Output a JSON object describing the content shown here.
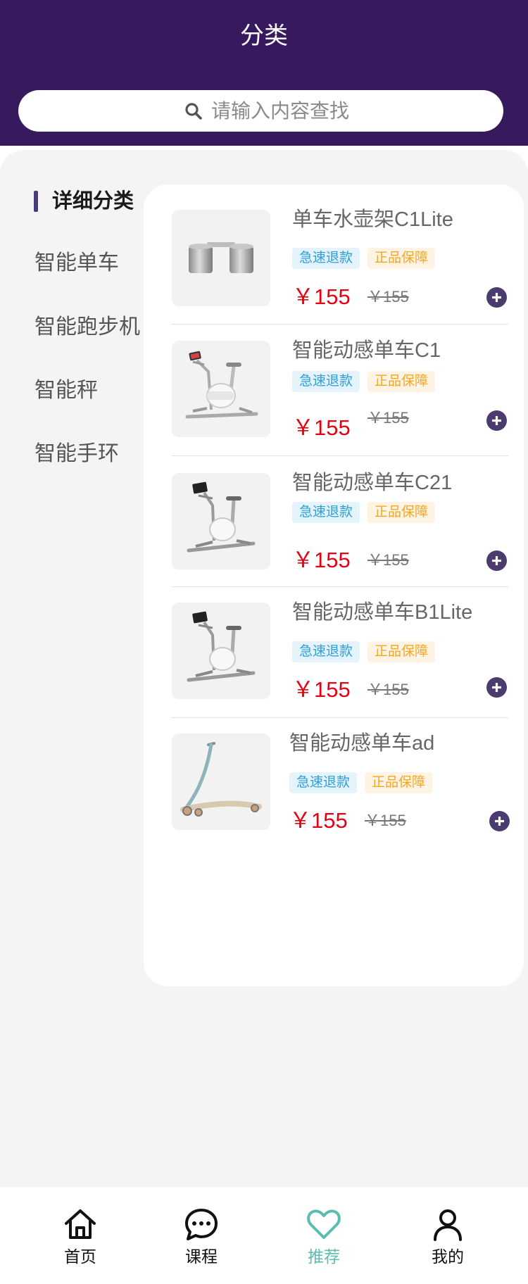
{
  "theme": {
    "header_bg": "#371a5e",
    "accent": "#4b3b6e",
    "price_color": "#e60012",
    "active_nav_color": "#5cbcb0",
    "page_bg": "#f4f4f5"
  },
  "header": {
    "title": "分类"
  },
  "search": {
    "placeholder": "请输入内容查找",
    "icon": "search-icon"
  },
  "sidebar": {
    "heading": "详细分类",
    "items": [
      {
        "label": "智能单车"
      },
      {
        "label": "智能跑步机"
      },
      {
        "label": "智能秤"
      },
      {
        "label": "智能手环"
      }
    ]
  },
  "products": [
    {
      "title": "单车水壶架C1Lite",
      "image": "bottle-cage-image",
      "badges": [
        "急速退款",
        "正品保障"
      ],
      "price": "￥155",
      "original_price": "￥155",
      "action_icon": "plus-circle-icon"
    },
    {
      "title": "智能动感单车C1",
      "image": "exercise-bike-image",
      "badges": [
        "急速退款",
        "正品保障"
      ],
      "price": "￥155",
      "original_price": "￥155",
      "action_icon": "plus-circle-icon"
    },
    {
      "title": "智能动感单车C21",
      "image": "exercise-bike-image",
      "badges": [
        "急速退款",
        "正品保障"
      ],
      "price": "￥155",
      "original_price": "￥155",
      "action_icon": "plus-circle-icon"
    },
    {
      "title": "智能动感单车B1Lite",
      "image": "exercise-bike-image",
      "badges": [
        "急速退款",
        "正品保障"
      ],
      "price": "￥155",
      "original_price": "￥155",
      "action_icon": "plus-circle-icon"
    },
    {
      "title": "智能动感单车ad",
      "image": "scooter-image",
      "badges": [
        "急速退款",
        "正品保障"
      ],
      "price": "￥155",
      "original_price": "￥155",
      "action_icon": "plus-circle-icon"
    }
  ],
  "nav": {
    "items": [
      {
        "label": "首页",
        "icon": "home-icon",
        "active": false
      },
      {
        "label": "课程",
        "icon": "chat-icon",
        "active": false
      },
      {
        "label": "推荐",
        "icon": "heart-icon",
        "active": true
      },
      {
        "label": "我的",
        "icon": "user-icon",
        "active": false
      }
    ]
  }
}
